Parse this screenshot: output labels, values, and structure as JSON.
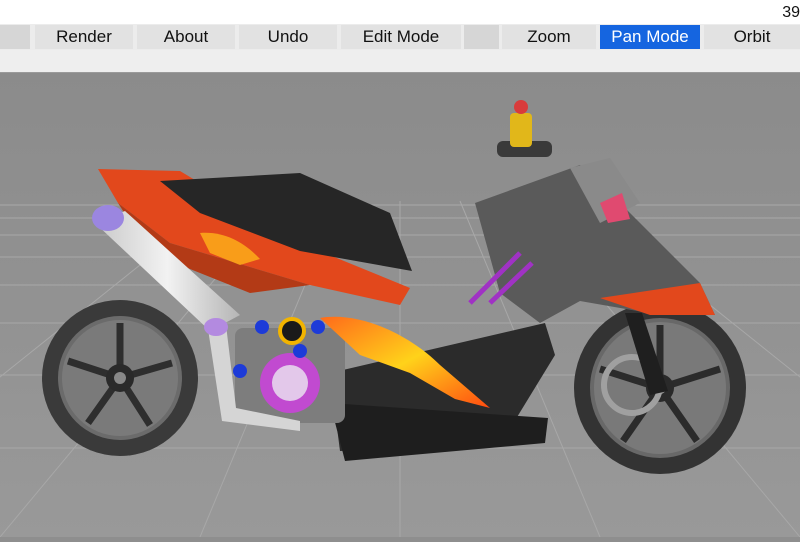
{
  "app": {
    "fps_counter": "39"
  },
  "toolbar": {
    "render_label": "Render",
    "about_label": "About",
    "undo_label": "Undo",
    "edit_mode_label": "Edit Mode",
    "zoom_label": "Zoom",
    "pan_mode_label": "Pan Mode",
    "orbit_label": "Orbit",
    "active_mode": "Pan Mode"
  },
  "colors": {
    "accent_active": "#1565e0",
    "toolbar_bg": "#ececec",
    "viewport_bg": "#8e8e8e",
    "body_orange": "#e2481c",
    "body_dark": "#2d2d2d",
    "exhaust_tip": "#9b86e0",
    "rim_color": "#3a3a3a",
    "accent_part": "#b03ac0"
  },
  "viewport": {
    "grid": "on",
    "model": "motorcycle-scooter",
    "background": "gray"
  }
}
